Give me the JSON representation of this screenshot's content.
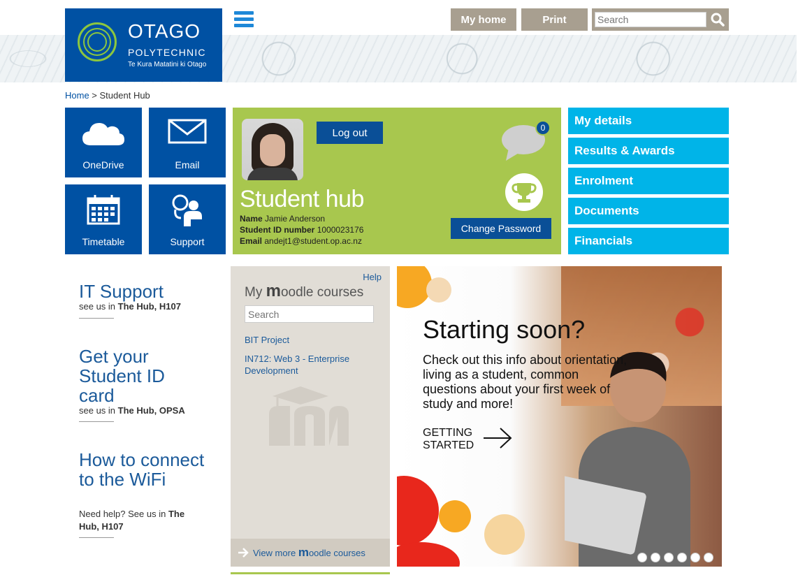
{
  "header": {
    "logo_line1": "OTAGO",
    "logo_line2": "POLYTECHNIC",
    "logo_line3": "Te Kura Matatini ki Otago",
    "my_home": "My home",
    "print": "Print",
    "search_placeholder": "Search"
  },
  "breadcrumb": {
    "home": "Home",
    "separator": " > ",
    "current": "Student Hub"
  },
  "tiles": [
    {
      "label": "OneDrive",
      "icon": "cloud-icon"
    },
    {
      "label": "Email",
      "icon": "envelope-icon"
    },
    {
      "label": "Timetable",
      "icon": "calendar-icon"
    },
    {
      "label": "Support",
      "icon": "support-person-icon"
    }
  ],
  "hub": {
    "logout": "Log out",
    "title": "Student hub",
    "name_label": "Name",
    "name": "Jamie Anderson",
    "id_label": "Student ID number",
    "id": "1000023176",
    "email_label": "Email",
    "email": "andejt1@student.op.ac.nz",
    "notification_count": "0",
    "change_password": "Change Password"
  },
  "menu": [
    {
      "label": "My details"
    },
    {
      "label": "Results & Awards"
    },
    {
      "label": "Enrolment"
    },
    {
      "label": "Documents"
    },
    {
      "label": "Financials"
    }
  ],
  "info": [
    {
      "title": "IT Support",
      "pre": "see us in",
      "location": "The Hub, H107"
    },
    {
      "title": "Get your Student ID card",
      "pre": "see us in",
      "location": "The Hub, OPSA"
    },
    {
      "title": "How to connect to the WiFi",
      "pre": "Need help? See us in",
      "location": "The Hub, H107"
    }
  ],
  "moodle": {
    "help": "Help",
    "title_prefix": "My",
    "title_brand": "m",
    "title_suffix": "oodle courses",
    "search_placeholder": "Search",
    "courses": [
      "BIT Project",
      "IN712: Web 3 - Enterprise Development"
    ],
    "view_more_prefix": "View more",
    "view_more_brand": "m",
    "view_more_suffix": "oodle courses"
  },
  "banner": {
    "headline": "Starting soon?",
    "body": "Check out this info about orientation, living as a student, common questions about your first week of study and more!",
    "cta_line1": "GETTING",
    "cta_line2": "STARTED",
    "slide_count": 6
  },
  "colors": {
    "brand_blue": "#0051a3",
    "hub_green": "#a8c74e",
    "menu_cyan": "#00b4e8",
    "button_tan": "#a89f90"
  }
}
